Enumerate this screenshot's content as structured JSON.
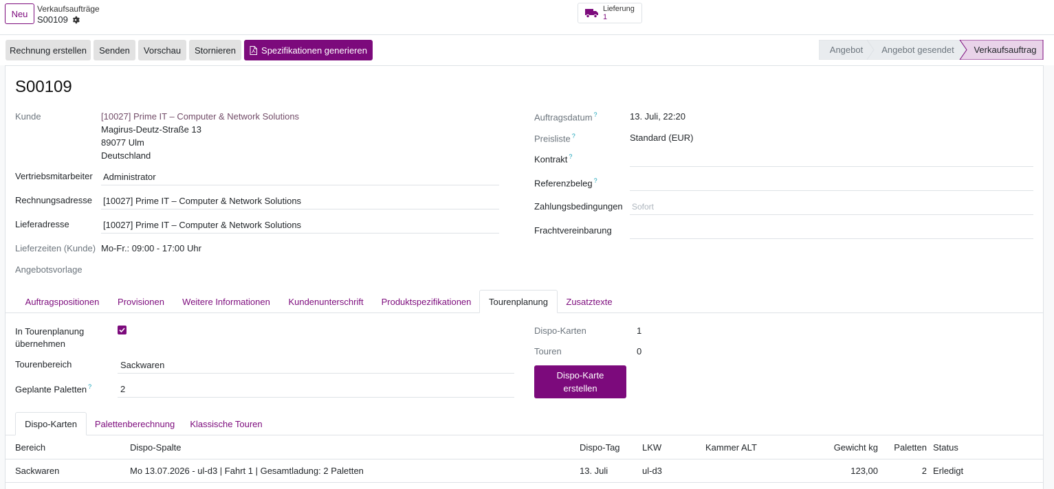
{
  "breadcrumb": {
    "new_label": "Neu",
    "parent": "Verkaufsaufträge",
    "current": "S00109"
  },
  "smart_button": {
    "label": "Lieferung",
    "value": "1"
  },
  "actions": {
    "invoice": "Rechnung erstellen",
    "send": "Senden",
    "preview": "Vorschau",
    "cancel": "Stornieren",
    "specs": "Spezifikationen generieren"
  },
  "statusbar": [
    "Angebot",
    "Angebot gesendet",
    "Verkaufsauftrag"
  ],
  "record": {
    "name": "S00109",
    "customer_label": "Kunde",
    "customer_name": "[10027] Prime IT – Computer & Network Solutions",
    "customer_street": "Magirus-Deutz-Straße 13",
    "customer_city": "89077 Ulm",
    "customer_country": "Deutschland",
    "salesperson_label": "Vertriebsmitarbeiter",
    "salesperson": "Administrator",
    "invoice_address_label": "Rechnungsadresse",
    "invoice_address": "[10027] Prime IT  – Computer & Network Solutions",
    "delivery_address_label": "Lieferadresse",
    "delivery_address": "[10027] Prime IT  – Computer & Network Solutions",
    "delivery_times_label": "Lieferzeiten (Kunde)",
    "delivery_times": "Mo-Fr.: 09:00 - 17:00 Uhr",
    "quote_template_label": "Angebotsvorlage",
    "order_date_label": "Auftragsdatum",
    "order_date": "13. Juli, 22:20",
    "pricelist_label": "Preisliste",
    "pricelist": "Standard (EUR)",
    "contract_label": "Kontrakt",
    "reference_label": "Referenzbeleg",
    "payment_terms_label": "Zahlungsbedingungen",
    "payment_terms_placeholder": "Sofort",
    "freight_label": "Frachtvereinbarung",
    "help_mark": "?"
  },
  "tabs": [
    "Auftragspositionen",
    "Provisionen",
    "Weitere Informationen",
    "Kundenunterschrift",
    "Produktspezifikationen",
    "Tourenplanung",
    "Zusatztexte"
  ],
  "tour": {
    "in_planning_label_1": "In Tourenplanung",
    "in_planning_label_2": "übernehmen",
    "in_planning_checked": true,
    "area_label": "Tourenbereich",
    "area": "Sackwaren",
    "pallets_label": "Geplante Paletten",
    "pallets": "2",
    "dispo_cards_label": "Dispo-Karten",
    "dispo_cards": "1",
    "tours_label": "Touren",
    "tours": "0",
    "create_button_1": "Dispo-Karte",
    "create_button_2": "erstellen"
  },
  "subtabs": [
    "Dispo-Karten",
    "Palettenberechnung",
    "Klassische Touren"
  ],
  "table": {
    "headers": [
      "Bereich",
      "Dispo-Spalte",
      "Dispo-Tag",
      "LKW",
      "Kammer ALT",
      "Gewicht kg",
      "Paletten",
      "Status"
    ],
    "rows": [
      [
        "Sackwaren",
        "Mo 13.07.2026 - ul-d3 | Fahrt 1 | Gesamtladung: 2 Paletten",
        "13. Juli",
        "ul-d3",
        "",
        "123,00",
        "2",
        "Erledigt"
      ]
    ]
  },
  "colors": {
    "brand": "#7c0a7c",
    "link": "#714B67",
    "status_active": "#e9d3e9"
  }
}
